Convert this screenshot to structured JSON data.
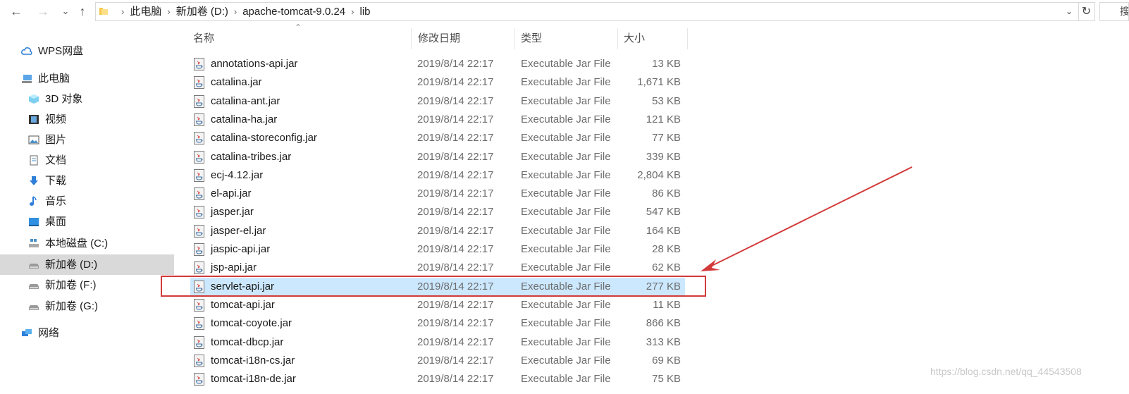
{
  "address": {
    "crumbs": [
      "此电脑",
      "新加卷 (D:)",
      "apache-tomcat-9.0.24",
      "lib"
    ],
    "search_placeholder": "搜"
  },
  "sidebar": {
    "items": [
      {
        "label": "WPS网盘",
        "icon": "cloud-icon"
      },
      {
        "label": "此电脑",
        "icon": "computer-icon"
      },
      {
        "label": "3D 对象",
        "icon": "cube-icon"
      },
      {
        "label": "视频",
        "icon": "film-icon"
      },
      {
        "label": "图片",
        "icon": "picture-icon"
      },
      {
        "label": "文档",
        "icon": "document-icon"
      },
      {
        "label": "下载",
        "icon": "download-arrow-icon"
      },
      {
        "label": "音乐",
        "icon": "music-note-icon"
      },
      {
        "label": "桌面",
        "icon": "desktop-icon"
      },
      {
        "label": "本地磁盘 (C:)",
        "icon": "drive-icon"
      },
      {
        "label": "新加卷 (D:)",
        "icon": "drive-icon",
        "selected": true
      },
      {
        "label": "新加卷 (F:)",
        "icon": "drive-icon"
      },
      {
        "label": "新加卷 (G:)",
        "icon": "drive-icon"
      },
      {
        "label": "网络",
        "icon": "network-icon"
      }
    ]
  },
  "columns": {
    "name": "名称",
    "date": "修改日期",
    "type": "类型",
    "size": "大小"
  },
  "files": [
    {
      "name": "annotations-api.jar",
      "date": "2019/8/14 22:17",
      "type": "Executable Jar File",
      "size": "13 KB"
    },
    {
      "name": "catalina.jar",
      "date": "2019/8/14 22:17",
      "type": "Executable Jar File",
      "size": "1,671 KB"
    },
    {
      "name": "catalina-ant.jar",
      "date": "2019/8/14 22:17",
      "type": "Executable Jar File",
      "size": "53 KB"
    },
    {
      "name": "catalina-ha.jar",
      "date": "2019/8/14 22:17",
      "type": "Executable Jar File",
      "size": "121 KB"
    },
    {
      "name": "catalina-storeconfig.jar",
      "date": "2019/8/14 22:17",
      "type": "Executable Jar File",
      "size": "77 KB"
    },
    {
      "name": "catalina-tribes.jar",
      "date": "2019/8/14 22:17",
      "type": "Executable Jar File",
      "size": "339 KB"
    },
    {
      "name": "ecj-4.12.jar",
      "date": "2019/8/14 22:17",
      "type": "Executable Jar File",
      "size": "2,804 KB"
    },
    {
      "name": "el-api.jar",
      "date": "2019/8/14 22:17",
      "type": "Executable Jar File",
      "size": "86 KB"
    },
    {
      "name": "jasper.jar",
      "date": "2019/8/14 22:17",
      "type": "Executable Jar File",
      "size": "547 KB"
    },
    {
      "name": "jasper-el.jar",
      "date": "2019/8/14 22:17",
      "type": "Executable Jar File",
      "size": "164 KB"
    },
    {
      "name": "jaspic-api.jar",
      "date": "2019/8/14 22:17",
      "type": "Executable Jar File",
      "size": "28 KB"
    },
    {
      "name": "jsp-api.jar",
      "date": "2019/8/14 22:17",
      "type": "Executable Jar File",
      "size": "62 KB"
    },
    {
      "name": "servlet-api.jar",
      "date": "2019/8/14 22:17",
      "type": "Executable Jar File",
      "size": "277 KB",
      "selected": true
    },
    {
      "name": "tomcat-api.jar",
      "date": "2019/8/14 22:17",
      "type": "Executable Jar File",
      "size": "11 KB"
    },
    {
      "name": "tomcat-coyote.jar",
      "date": "2019/8/14 22:17",
      "type": "Executable Jar File",
      "size": "866 KB"
    },
    {
      "name": "tomcat-dbcp.jar",
      "date": "2019/8/14 22:17",
      "type": "Executable Jar File",
      "size": "313 KB"
    },
    {
      "name": "tomcat-i18n-cs.jar",
      "date": "2019/8/14 22:17",
      "type": "Executable Jar File",
      "size": "69 KB"
    },
    {
      "name": "tomcat-i18n-de.jar",
      "date": "2019/8/14 22:17",
      "type": "Executable Jar File",
      "size": "75 KB"
    }
  ],
  "watermark": "https://blog.csdn.net/qq_44543508",
  "colors": {
    "selection": "#cce8ff",
    "annotation": "#d23a3a",
    "nav_selected": "#d9d9d9"
  }
}
